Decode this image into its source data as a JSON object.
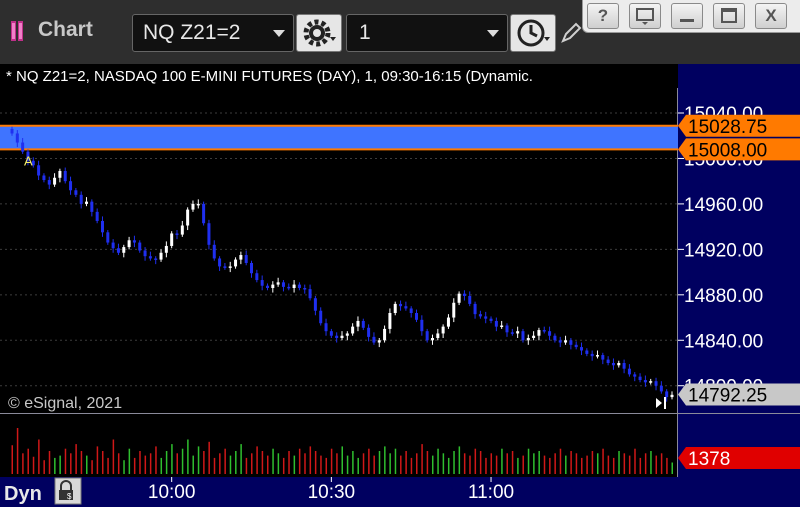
{
  "window": {
    "title": "Chart",
    "symbol": "NQ Z21=2",
    "interval": "1",
    "help_label": "?",
    "close_label": "X"
  },
  "chart_data": {
    "type": "candlestick",
    "title": "* NQ Z21=2, NASDAQ 100 E-MINI FUTURES (DAY), 1, 09:30-16:15 (Dynamic.",
    "watermark": "© eSignal, 2021",
    "ylim": [
      14776,
      15062
    ],
    "y_ticks": [
      15040,
      15000,
      14960,
      14920,
      14880,
      14840,
      14800
    ],
    "y_tick_labels": [
      "15040.00",
      "15000.00",
      "14960.00",
      "14920.00",
      "14880.00",
      "14840.00",
      "14800.00"
    ],
    "x_tick_labels": [
      "10:00",
      "10:30",
      "11:00"
    ],
    "x_tick_bar_index": [
      30,
      60,
      90
    ],
    "time_start": "09:30",
    "band": {
      "upper": 15028.75,
      "lower": 15008.0,
      "upper_label": "15028.75",
      "lower_label": "15008.00",
      "color": "#3f74ff"
    },
    "last_price": 14792.25,
    "last_price_label": "14792.25",
    "annotation": {
      "label": "A",
      "bar_index": 3,
      "price": 14994
    },
    "volume_label": "1378",
    "volume_mode_label": "Dyn",
    "colors": {
      "up": "#ffffff",
      "down": "#1f2ff0",
      "vol_up": "#2fbf2f",
      "vol_down": "#d01818",
      "price_tag": "#ff7a00",
      "vol_tag": "#e00000"
    },
    "closes": [
      15022,
      15014,
      15006,
      14998,
      14994,
      14985,
      14981,
      14977,
      14983,
      14989,
      14980,
      14972,
      14968,
      14960,
      14962,
      14953,
      14945,
      14935,
      14926,
      14921,
      14917,
      14922,
      14928,
      14926,
      14919,
      14914,
      14912,
      14911,
      14917,
      14923,
      14934,
      14933,
      14941,
      14955,
      14960,
      14960,
      14943,
      14924,
      14912,
      14905,
      14904,
      14905,
      14911,
      14915,
      14908,
      14899,
      14893,
      14888,
      14886,
      14889,
      14891,
      14887,
      14886,
      14889,
      14886,
      14885,
      14877,
      14866,
      14855,
      14848,
      14844,
      14842,
      14844,
      14846,
      14852,
      14857,
      14851,
      14843,
      14838,
      14840,
      14850,
      14864,
      14872,
      14870,
      14868,
      14864,
      14858,
      14848,
      14840,
      14842,
      14846,
      14852,
      14860,
      14873,
      14881,
      14879,
      14872,
      14863,
      14861,
      14859,
      14857,
      14852,
      14853,
      14847,
      14846,
      14848,
      14840,
      14842,
      14844,
      14849,
      14848,
      14844,
      14840,
      14838,
      14840,
      14836,
      14834,
      14831,
      14828,
      14826,
      14827,
      14823,
      14820,
      14818,
      14820,
      14815,
      14810,
      14808,
      14805,
      14803,
      14804,
      14800,
      14795,
      14790,
      14792
    ],
    "volumes": [
      25,
      40,
      18,
      22,
      15,
      30,
      12,
      20,
      14,
      16,
      22,
      18,
      26,
      20,
      16,
      12,
      24,
      20,
      14,
      30,
      18,
      12,
      22,
      14,
      20,
      16,
      18,
      24,
      14,
      20,
      26,
      18,
      22,
      30,
      16,
      24,
      20,
      28,
      14,
      18,
      22,
      16,
      20,
      26,
      14,
      18,
      24,
      20,
      16,
      22,
      18,
      14,
      20,
      16,
      22,
      18,
      24,
      20,
      16,
      14,
      22,
      18,
      24,
      16,
      20,
      14,
      18,
      22,
      16,
      20,
      24,
      18,
      22,
      16,
      20,
      14,
      18,
      26,
      20,
      16,
      22,
      18,
      14,
      20,
      24,
      18,
      16,
      22,
      20,
      14,
      18,
      16,
      22,
      18,
      20,
      14,
      16,
      22,
      18,
      20,
      16,
      14,
      18,
      22,
      16,
      20,
      18,
      14,
      16,
      20,
      18,
      22,
      16,
      14,
      20,
      18,
      16,
      22,
      14,
      18,
      20,
      16,
      18,
      14,
      10
    ]
  }
}
